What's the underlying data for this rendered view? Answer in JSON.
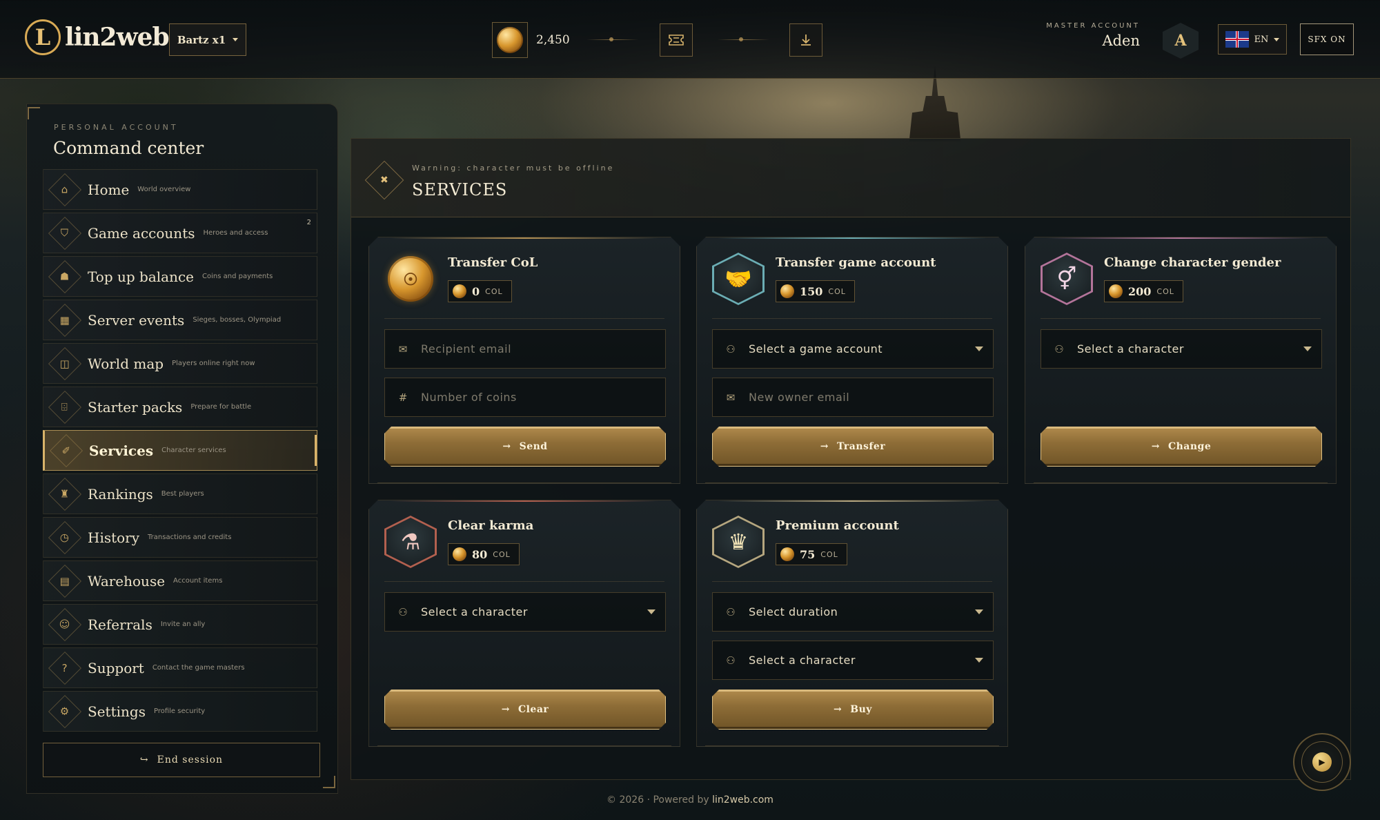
{
  "brand": {
    "logo_letter": "L",
    "name": "lin2web"
  },
  "header": {
    "server": "Bartz x1",
    "balance": "2,450",
    "master_label": "MASTER ACCOUNT",
    "master_name": "Aden",
    "avatar_letter": "A",
    "language": "EN",
    "sfx": "SFX ON"
  },
  "sidebar": {
    "label": "PERSONAL ACCOUNT",
    "title": "Command center",
    "items": [
      {
        "label": "Home",
        "sub": "World overview",
        "icon": "⌂"
      },
      {
        "label": "Game accounts",
        "sub": "Heroes and access",
        "icon": "⛉",
        "badge": "2"
      },
      {
        "label": "Top up balance",
        "sub": "Coins and payments",
        "icon": "☗"
      },
      {
        "label": "Server events",
        "sub": "Sieges, bosses, Olympiad",
        "icon": "▦"
      },
      {
        "label": "World map",
        "sub": "Players online right now",
        "icon": "◫"
      },
      {
        "label": "Starter packs",
        "sub": "Prepare for battle",
        "icon": "⌹"
      },
      {
        "label": "Services",
        "sub": "Character services",
        "icon": "✐"
      },
      {
        "label": "Rankings",
        "sub": "Best players",
        "icon": "♜"
      },
      {
        "label": "History",
        "sub": "Transactions and credits",
        "icon": "◷"
      },
      {
        "label": "Warehouse",
        "sub": "Account items",
        "icon": "▤"
      },
      {
        "label": "Referrals",
        "sub": "Invite an ally",
        "icon": "☺"
      },
      {
        "label": "Support",
        "sub": "Contact the game masters",
        "icon": "?"
      },
      {
        "label": "Settings",
        "sub": "Profile security",
        "icon": "⚙"
      }
    ],
    "active_index": 6,
    "end_session": "End session"
  },
  "panel": {
    "warning": "Warning: character must be offline",
    "title": "SERVICES"
  },
  "services": {
    "currency": "COL",
    "transfer_col": {
      "title": "Transfer CoL",
      "price": "0",
      "recipient_placeholder": "Recipient email",
      "coins_placeholder": "Number of coins",
      "button": "Send"
    },
    "transfer_account": {
      "title": "Transfer game account",
      "price": "150",
      "select_account": "Select a game account",
      "owner_placeholder": "New owner email",
      "button": "Transfer"
    },
    "change_gender": {
      "title": "Change character gender",
      "price": "200",
      "select_character": "Select a character",
      "button": "Change"
    },
    "clear_karma": {
      "title": "Clear karma",
      "price": "80",
      "select_character": "Select a character",
      "button": "Clear"
    },
    "premium": {
      "title": "Premium account",
      "price": "75",
      "select_duration": "Select duration",
      "select_character": "Select a character",
      "button": "Buy"
    }
  },
  "colors": {
    "accent_gold": "#d9b36a",
    "card_teal": "#7fd1d8",
    "card_pink": "#d98ab8",
    "card_red": "#d9705a"
  },
  "footer": {
    "prefix": "© 2026 · Powered by ",
    "link": "lin2web.com"
  }
}
